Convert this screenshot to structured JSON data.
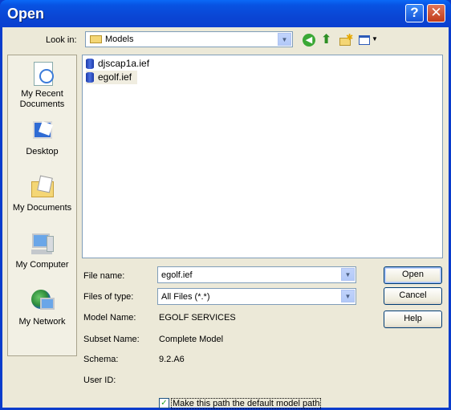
{
  "window": {
    "title": "Open",
    "help_glyph": "?",
    "close_glyph": "✕"
  },
  "lookin": {
    "label": "Look in:",
    "value": "Models"
  },
  "places": [
    {
      "label": "My Recent Documents",
      "icon": "recent-documents-icon"
    },
    {
      "label": "Desktop",
      "icon": "desktop-icon"
    },
    {
      "label": "My Documents",
      "icon": "my-documents-icon"
    },
    {
      "label": "My Computer",
      "icon": "my-computer-icon"
    },
    {
      "label": "My Network",
      "icon": "my-network-icon"
    }
  ],
  "files": [
    {
      "name": "djscap1a.ief",
      "selected": false
    },
    {
      "name": "egolf.ief",
      "selected": true
    }
  ],
  "form": {
    "file_name_label": "File name:",
    "file_name_value": "egolf.ief",
    "file_type_label": "Files of type:",
    "file_type_value": "All Files (*.*)",
    "model_name_label": "Model Name:",
    "model_name_value": "EGOLF SERVICES",
    "subset_name_label": "Subset Name:",
    "subset_name_value": "Complete Model",
    "schema_label": "Schema:",
    "schema_value": "9.2.A6",
    "user_id_label": "User ID:",
    "user_id_value": ""
  },
  "buttons": {
    "open": "Open",
    "cancel": "Cancel",
    "help": "Help"
  },
  "checkbox": {
    "label": "Make this path the default model path",
    "checked": true
  },
  "colors": {
    "titlebar": "#0a46d4",
    "dialog_bg": "#ece9d8",
    "accent": "#0a3ccc"
  }
}
